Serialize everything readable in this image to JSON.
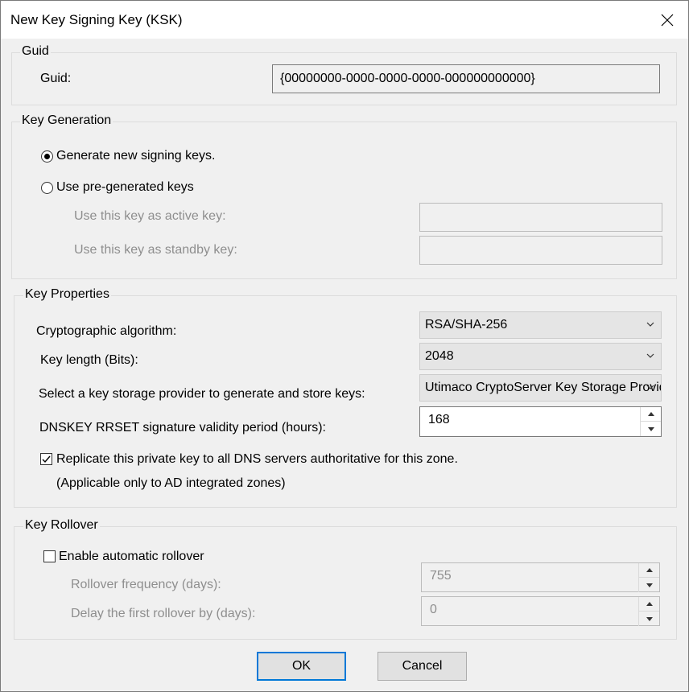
{
  "window": {
    "title": "New Key Signing Key (KSK)"
  },
  "guid_group": {
    "legend": "Guid",
    "label": "Guid:",
    "value": "{00000000-0000-0000-0000-000000000000}"
  },
  "key_generation": {
    "legend": "Key Generation",
    "generate_new": {
      "label": "Generate new signing keys.",
      "selected": true
    },
    "use_pregenerated": {
      "label": "Use pre-generated keys",
      "selected": false
    },
    "active_key_label": "Use this key as active key:",
    "active_key_value": "",
    "standby_key_label": "Use this key as standby key:",
    "standby_key_value": ""
  },
  "key_properties": {
    "legend": "Key Properties",
    "algorithm_label": "Cryptographic algorithm:",
    "algorithm_value": "RSA/SHA-256",
    "key_length_label": "Key length (Bits):",
    "key_length_value": "2048",
    "ksp_label": "Select a key storage provider to generate and store keys:",
    "ksp_value": "Utimaco CryptoServer Key Storage Provider",
    "validity_label": "DNSKEY RRSET signature validity period (hours):",
    "validity_value": "168",
    "replicate": {
      "label": "Replicate this private key to all DNS servers authoritative for this zone.",
      "checked": true
    },
    "replicate_note": "(Applicable only to AD integrated zones)"
  },
  "key_rollover": {
    "legend": "Key Rollover",
    "enable": {
      "label": "Enable automatic rollover",
      "checked": false
    },
    "frequency_label": "Rollover frequency (days):",
    "frequency_value": "755",
    "delay_label": "Delay the first rollover by (days):",
    "delay_value": "0"
  },
  "buttons": {
    "ok": "OK",
    "cancel": "Cancel"
  },
  "colors": {
    "focus_border": "#0078d7",
    "disabled_text": "#8e8e8e"
  }
}
